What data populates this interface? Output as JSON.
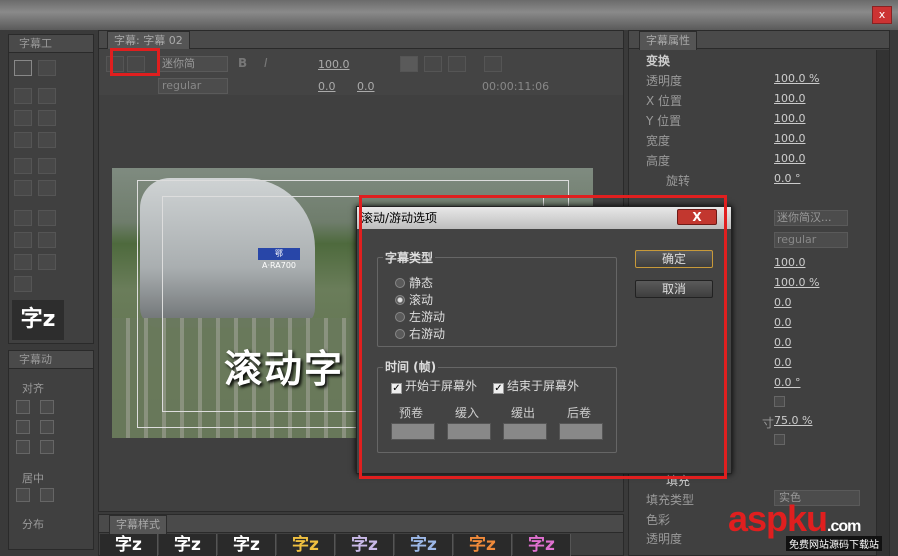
{
  "window": {
    "close_glyph": "x"
  },
  "panels": {
    "tools_title": "字幕工",
    "title_tab": "字幕: 字幕 02",
    "props_title": "字幕属性",
    "actions_title": "字幕动",
    "styles_title": "字幕样式"
  },
  "toolbar": {
    "font_family": "迷你简",
    "font_style": "regular",
    "font_size": "100.0",
    "kerning": "0.0",
    "leading": "0.0",
    "timecode": "00:00:11:06",
    "bold": "B",
    "italic": "I"
  },
  "tools": {
    "text_preview": "字z"
  },
  "actions": {
    "align_label": "对齐",
    "center_label": "居中",
    "distribute_label": "分布"
  },
  "canvas": {
    "scroll_text": "滚动字",
    "plate": "鄂 A·RA700"
  },
  "properties": {
    "transform": "变换",
    "rows": [
      {
        "label": "透明度",
        "value": "100.0 %"
      },
      {
        "label": "X 位置",
        "value": "100.0"
      },
      {
        "label": "Y 位置",
        "value": "100.0"
      },
      {
        "label": "宽度",
        "value": "100.0"
      },
      {
        "label": "高度",
        "value": "100.0"
      },
      {
        "label": "旋转",
        "value": "0.0 °"
      }
    ],
    "font_value": "迷你简汉...",
    "style_value": "regular",
    "extra_values": [
      "100.0",
      "100.0 %",
      "0.0",
      "0.0",
      "0.0",
      "0.0",
      "0.0",
      "0.0 °"
    ],
    "scale_label": "寸",
    "scale_value": "75.0 %",
    "fill_section": "填充",
    "fill_type_label": "填充类型",
    "fill_type_value": "实色",
    "color_label": "色彩",
    "opacity_label": "透明度"
  },
  "styles": {
    "thumbs": [
      "字z",
      "字z",
      "字z",
      "字z",
      "字z",
      "字z",
      "字z",
      "字z"
    ]
  },
  "dialog": {
    "title": "滚动/游动选项",
    "close": "X",
    "type_group": "字幕类型",
    "types": [
      {
        "label": "静态",
        "selected": false
      },
      {
        "label": "滚动",
        "selected": true
      },
      {
        "label": "左游动",
        "selected": false
      },
      {
        "label": "右游动",
        "selected": false
      }
    ],
    "timing_group": "时间 (帧)",
    "start_off": "开始于屏幕外",
    "end_off": "结束于屏幕外",
    "check_glyph": "✓",
    "fields": [
      "预卷",
      "缓入",
      "缓出",
      "后卷"
    ],
    "ok": "确定",
    "cancel": "取消"
  },
  "watermark": {
    "brand": "aspku",
    "suffix": ".com",
    "tagline": "免费网站源码下载站"
  },
  "colors": {
    "accent_red": "#e01f1f",
    "dialog_bg": "#434343",
    "panel_bg": "#404040"
  }
}
